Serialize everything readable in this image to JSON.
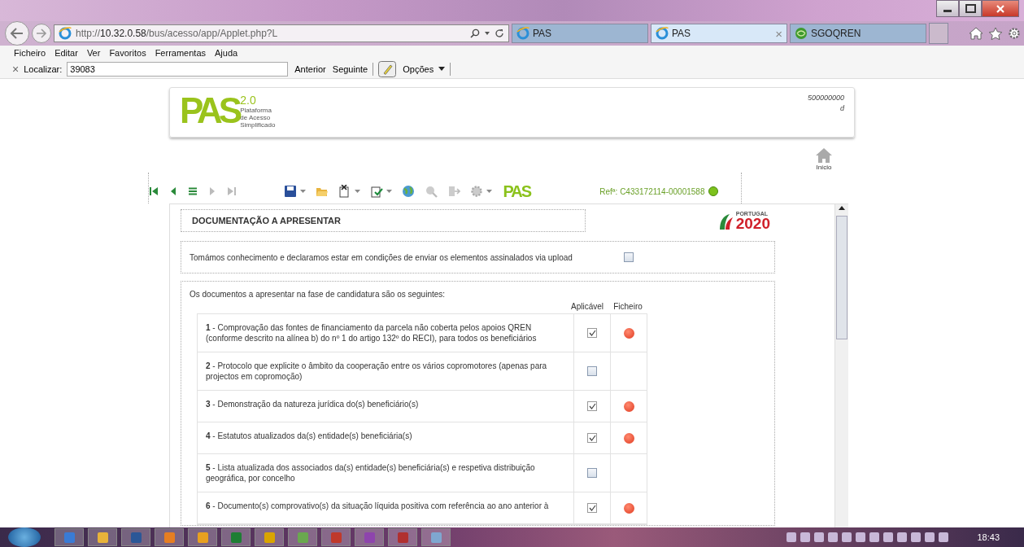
{
  "browser": {
    "address": {
      "prefix": "http://",
      "host": "10.32.0.58",
      "path": "/bus/acesso/app/Applet.php?L"
    },
    "tabs": [
      {
        "label": "PAS",
        "kind": "ie",
        "selected": false
      },
      {
        "label": "PAS",
        "kind": "ie",
        "selected": true
      },
      {
        "label": "SGOQREN",
        "kind": "green",
        "selected": false
      }
    ],
    "close_tab": "×",
    "menu": [
      "Ficheiro",
      "Editar",
      "Ver",
      "Favoritos",
      "Ferramentas",
      "Ajuda"
    ],
    "find": {
      "close": "×",
      "label": "Localizar:",
      "value": "39083",
      "previous": "Anterior",
      "next": "Seguinte",
      "options": "Opções"
    }
  },
  "header": {
    "logo": "PAS",
    "version": "2.0",
    "tagline": [
      "Plataforma",
      "de Acesso",
      "Simplificado"
    ],
    "user_id": "500000000",
    "user_suffix": "d",
    "home": "Início"
  },
  "toolbar": {
    "logo": "PAS",
    "reference": "Refª: C433172114-00001588"
  },
  "section_title": "DOCUMENTAÇÃO A APRESENTAR",
  "program_logo": {
    "country": "PORTUGAL",
    "year": "2020"
  },
  "declaration": {
    "text": "Tomámos conhecimento e declaramos estar em condições de enviar os elementos assinalados via upload",
    "checked": false
  },
  "documents": {
    "intro": "Os documentos a apresentar na fase de candidatura são os seguintes:",
    "columns": [
      "Aplicável",
      "Ficheiro"
    ],
    "rows": [
      {
        "number": "1",
        "text": "- Comprovação das fontes de financiamento da parcela não coberta pelos apoios QREN (conforme descrito na alínea b) do nº 1 do artigo 132º do RECI), para todos os beneficiários",
        "applicable": true,
        "file_missing": true
      },
      {
        "number": "2",
        "text": "- Protocolo que explicite o âmbito da cooperação entre os vários copromotores (apenas para projectos em copromoção)",
        "applicable": false,
        "file_missing": false
      },
      {
        "number": "3",
        "text": "- Demonstração da natureza jurídica do(s) beneficiário(s)",
        "applicable": true,
        "file_missing": true
      },
      {
        "number": "4",
        "text": "- Estatutos atualizados da(s) entidade(s) beneficiária(s)",
        "applicable": true,
        "file_missing": true
      },
      {
        "number": "5",
        "text": "- Lista atualizada dos associados da(s) entidade(s) beneficiária(s) e respetiva distribuição geográfica, por concelho",
        "applicable": false,
        "file_missing": false
      },
      {
        "number": "6",
        "text": "- Documento(s) comprovativo(s) da situação líquida positiva com referência ao ano anterior à",
        "applicable": true,
        "file_missing": true
      }
    ]
  },
  "taskbar": {
    "clock": "18:43"
  }
}
